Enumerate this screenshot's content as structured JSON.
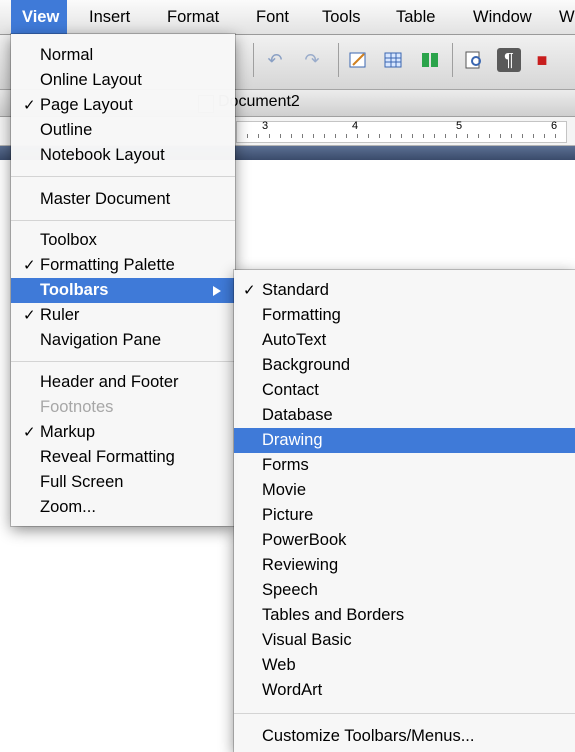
{
  "menubar": {
    "items": [
      "View",
      "Insert",
      "Format",
      "Font",
      "Tools",
      "Table",
      "Window",
      "W"
    ]
  },
  "document": {
    "title": "Document2",
    "ruler_numbers": [
      "3",
      "4",
      "5",
      "6"
    ]
  },
  "colors": {
    "highlight": "#3f7ad8",
    "disabled": "#a7a7a7"
  },
  "view_menu": {
    "items": [
      {
        "label": "Normal",
        "checked": false
      },
      {
        "label": "Online Layout",
        "checked": false
      },
      {
        "label": "Page Layout",
        "checked": true
      },
      {
        "label": "Outline",
        "checked": false
      },
      {
        "label": "Notebook Layout",
        "checked": false
      },
      {
        "label": "Master Document",
        "checked": false
      },
      {
        "label": "Toolbox",
        "checked": false
      },
      {
        "label": "Formatting Palette",
        "checked": true
      },
      {
        "label": "Toolbars",
        "checked": false,
        "submenu": true,
        "highlighted": true
      },
      {
        "label": "Ruler",
        "checked": true
      },
      {
        "label": "Navigation Pane",
        "checked": false
      },
      {
        "label": "Header and Footer",
        "checked": false
      },
      {
        "label": "Footnotes",
        "checked": false,
        "disabled": true
      },
      {
        "label": "Markup",
        "checked": true
      },
      {
        "label": "Reveal Formatting",
        "checked": false
      },
      {
        "label": "Full Screen",
        "checked": false
      },
      {
        "label": "Zoom...",
        "checked": false
      }
    ],
    "checkmark": "✓"
  },
  "toolbars_menu": {
    "items": [
      {
        "label": "Standard",
        "checked": true
      },
      {
        "label": "Formatting",
        "checked": false
      },
      {
        "label": "AutoText",
        "checked": false
      },
      {
        "label": "Background",
        "checked": false
      },
      {
        "label": "Contact",
        "checked": false
      },
      {
        "label": "Database",
        "checked": false
      },
      {
        "label": "Drawing",
        "checked": false,
        "highlighted": true
      },
      {
        "label": "Forms",
        "checked": false
      },
      {
        "label": "Movie",
        "checked": false
      },
      {
        "label": "Picture",
        "checked": false
      },
      {
        "label": "PowerBook",
        "checked": false
      },
      {
        "label": "Reviewing",
        "checked": false
      },
      {
        "label": "Speech",
        "checked": false
      },
      {
        "label": "Tables and Borders",
        "checked": false
      },
      {
        "label": "Visual Basic",
        "checked": false
      },
      {
        "label": "Web",
        "checked": false
      },
      {
        "label": "WordArt",
        "checked": false
      },
      {
        "label": "Customize Toolbars/Menus...",
        "checked": false
      }
    ],
    "checkmark": "✓"
  }
}
